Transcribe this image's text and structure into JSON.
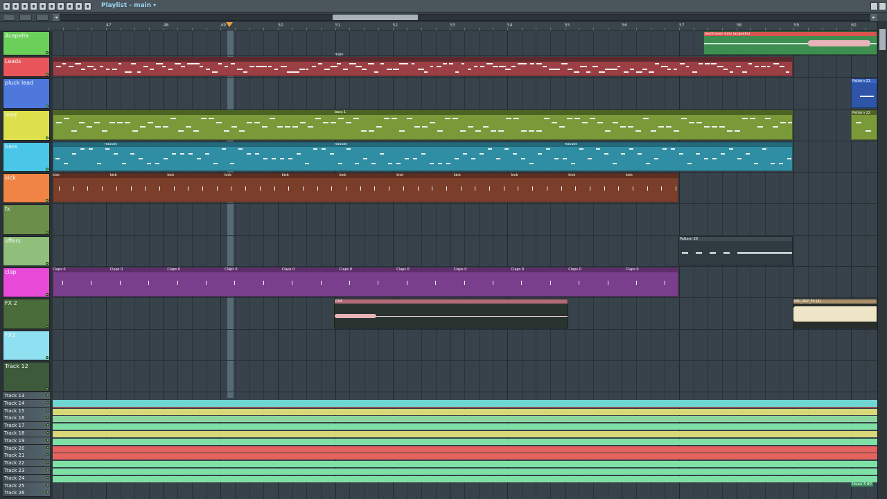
{
  "window": {
    "title": "Playlist - main",
    "title_arrow": "▾"
  },
  "ruler": {
    "bars": [
      "47",
      "48",
      "49",
      "50",
      "51",
      "52",
      "53",
      "54",
      "55",
      "56",
      "57",
      "58",
      "59",
      "60"
    ]
  },
  "tracks": [
    {
      "name": "Acapella",
      "color": "#6ad05a"
    },
    {
      "name": "Leads",
      "color": "#e8565c"
    },
    {
      "name": "pluck lead",
      "color": "#4f78dd"
    },
    {
      "name": "lead",
      "color": "#dde04a"
    },
    {
      "name": "bass",
      "color": "#49c6e8"
    },
    {
      "name": "kick",
      "color": "#f08444"
    },
    {
      "name": "fx",
      "color": "#6b8f4a"
    },
    {
      "name": "offers",
      "color": "#8fbf7a"
    },
    {
      "name": "clap",
      "color": "#e84ad8"
    },
    {
      "name": "FX 2",
      "color": "#4a6b3a"
    },
    {
      "name": "FX3",
      "color": "#8fe0f0"
    },
    {
      "name": "Track 12",
      "color": "#3d5a3a"
    }
  ],
  "small_tracks": [
    "Track 13",
    "Track 14",
    "Track 15",
    "Track 16",
    "Track 17",
    "Track 18",
    "Track 19",
    "Track 20",
    "Track 21",
    "Track 22",
    "Track 23",
    "Track 24",
    "Track 25",
    "Track 26"
  ],
  "clips": {
    "acapella": "beethoven dolo (acapella)",
    "leads": "main",
    "pluck": "Pattern 21",
    "lead": "bass 1",
    "lead_end": "Pattern 22",
    "bass_a": "nuuuss",
    "bass_b": "nuuuss",
    "bass_c": "nuuuss",
    "kick": "kick",
    "offers": "Pattern 20",
    "clap": "Claps 0",
    "fx2_a": "034",
    "fx2_b": "HDI_267_FX (4)",
    "auto_end": "Lbuss 3 #2"
  }
}
